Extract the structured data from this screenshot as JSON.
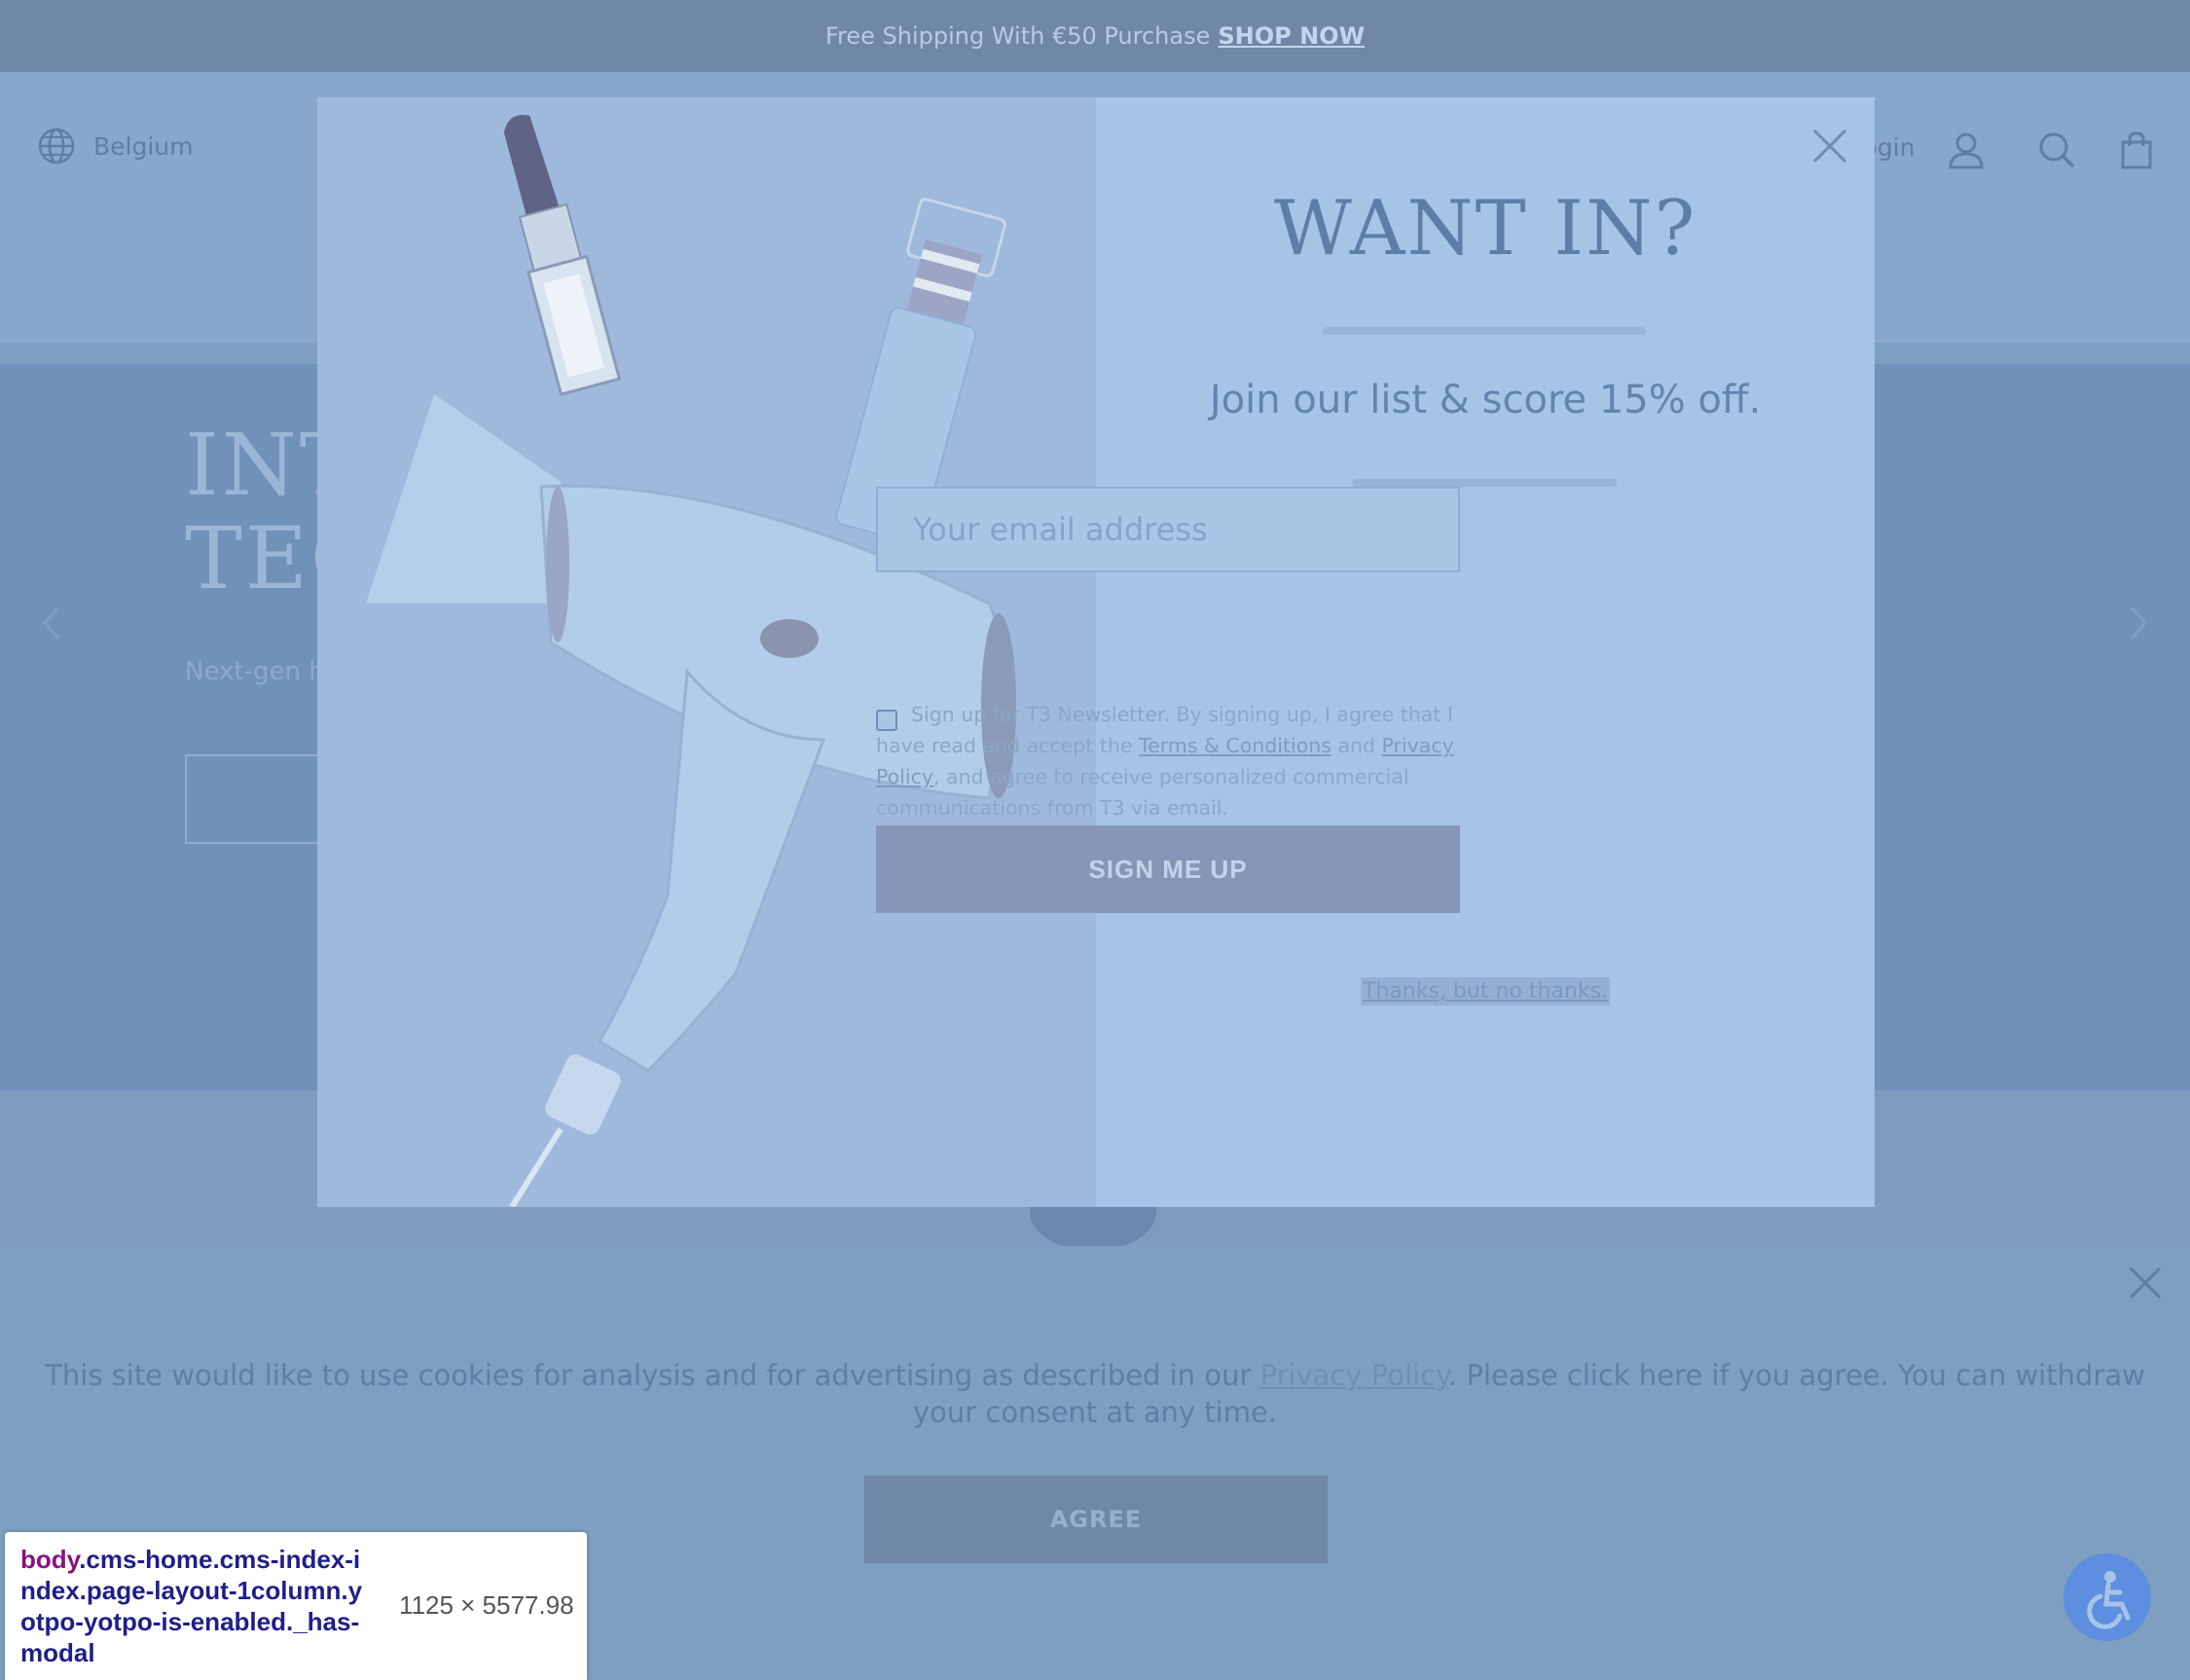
{
  "announcement": {
    "text": "Free Shipping With €50 Purchase",
    "link": "SHOP NOW"
  },
  "header": {
    "region": "Belgium",
    "login": "Login"
  },
  "hero": {
    "title_line1": "INT",
    "title_line2": "TEC",
    "subtitle": "Next-gen h"
  },
  "modal": {
    "heading": "WANT IN?",
    "subheading": "Join our list & score 15% off.",
    "email_placeholder": "Your email address",
    "consent_pre": "Sign up for T3 Newsletter. By signing up, I agree that I have read and accept the ",
    "terms_link": "Terms & Conditions",
    "consent_and": " and ",
    "privacy_link": "Privacy Policy",
    "consent_post": ", and agree to receive personalized commercial communications from T3 via email.",
    "submit_label": "SIGN ME UP",
    "decline_label": "Thanks, but no thanks."
  },
  "cookie": {
    "text_pre": "This site would like to use cookies for analysis and for advertising as described in our ",
    "privacy_link": "Privacy Policy",
    "text_post": ". Please click here if you agree. You can withdraw your consent at any time.",
    "agree_label": "AGREE"
  },
  "devtools_tooltip": {
    "tag": "body",
    "classes": ".cms-home.cms-index-index.page-layout-1column.yotpo-yotpo-is-enabled._has-modal",
    "dimensions": "1125 × 5577.98"
  },
  "icons": {
    "globe": "globe-icon",
    "account": "user-icon",
    "search": "search-icon",
    "cart": "shopping-bag-icon",
    "close": "close-icon",
    "accessibility": "wheelchair-icon"
  },
  "colors": {
    "overlay": "#7f9fc0",
    "modal_bg": "#a6c4e6",
    "button": "#8796b7",
    "accessibility": "#5d8ee0"
  }
}
